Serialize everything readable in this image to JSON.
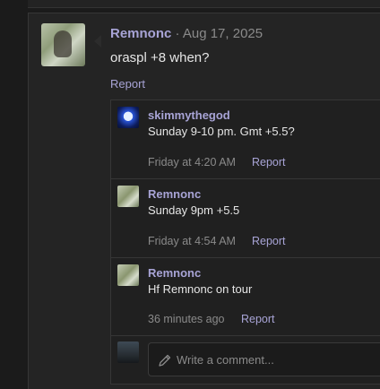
{
  "post": {
    "author": "Remnonc",
    "separator": " · ",
    "date": "Aug 17, 2025",
    "body": "oraspl +8 when?",
    "report_label": "Report"
  },
  "comments": [
    {
      "author": "skimmythegod",
      "text": "Sunday 9-10 pm. Gmt +5.5?",
      "time": "Friday at 4:20 AM",
      "report_label": "Report"
    },
    {
      "author": "Remnonc",
      "text": "Sunday 9pm +5.5",
      "time": "Friday at 4:54 AM",
      "report_label": "Report"
    },
    {
      "author": "Remnonc",
      "text": "Hf Remnonc on tour",
      "time": "36 minutes ago",
      "report_label": "Report"
    }
  ],
  "reply": {
    "placeholder": "Write a comment..."
  },
  "colors": {
    "accent": "#a8a4d6",
    "text": "#e6e6e6",
    "muted": "#8a8a8a",
    "background": "#1b1b1b"
  }
}
